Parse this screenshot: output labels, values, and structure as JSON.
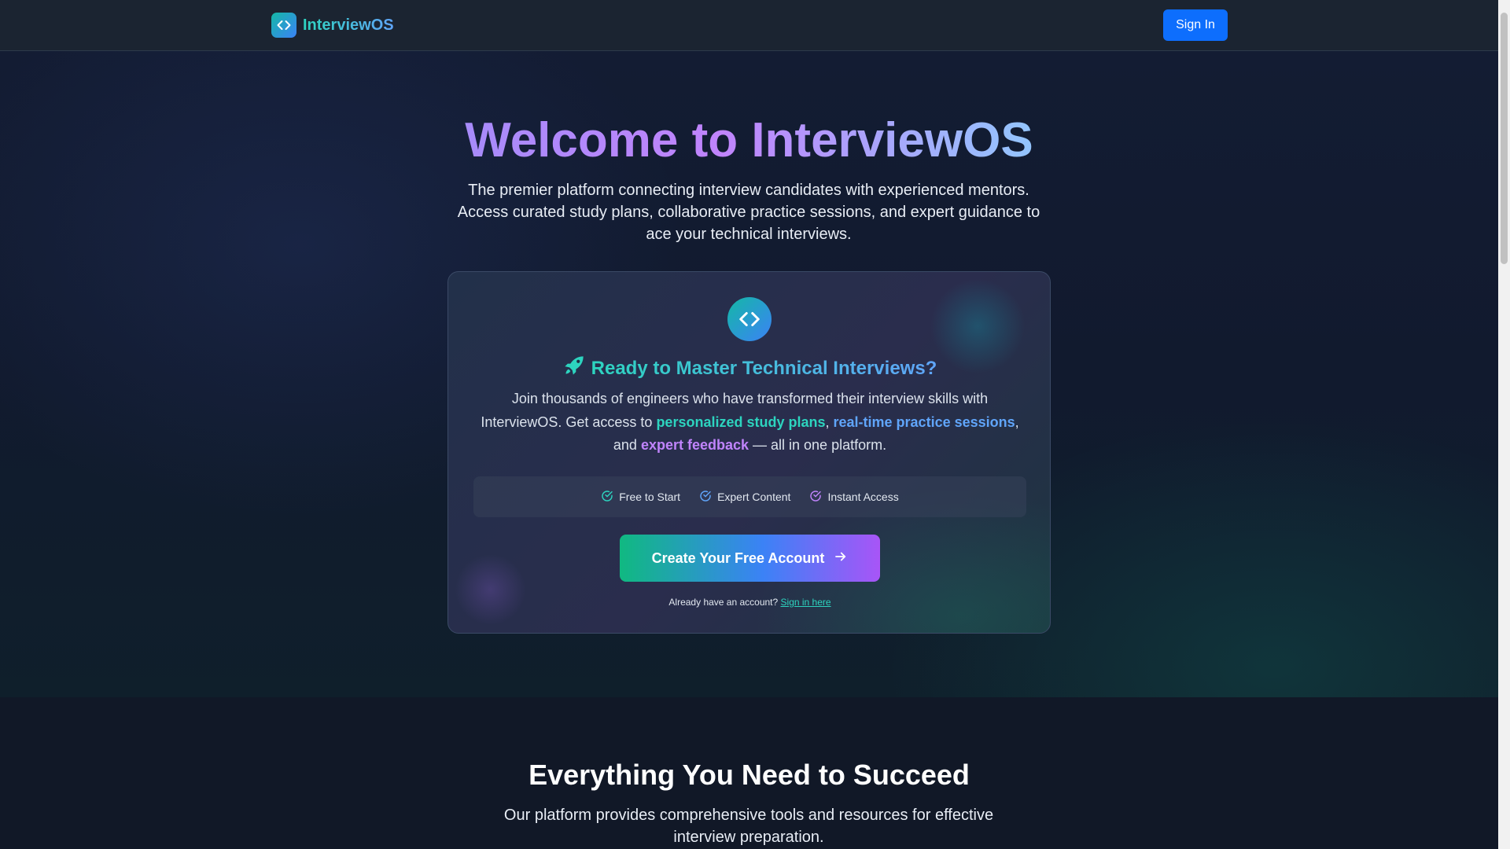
{
  "navbar": {
    "brand_name": "InterviewOS",
    "sign_in_label": "Sign In"
  },
  "hero": {
    "title": "Welcome to InterviewOS",
    "subtitle": "The premier platform connecting interview candidates with experienced mentors. Access curated study plans, collaborative practice sessions, and expert guidance to ace your technical interviews."
  },
  "card": {
    "heading": "Ready to Master Technical Interviews?",
    "desc_part1": "Join thousands of engineers who have transformed their interview skills with InterviewOS. Get access to ",
    "highlight1": "personalized study plans",
    "sep1": ", ",
    "highlight2": "real-time practice sessions",
    "sep2": ", and ",
    "highlight3": "expert feedback",
    "desc_part2": " — all in one platform.",
    "features": [
      {
        "label": "Free to Start",
        "color": "#2dd4bf"
      },
      {
        "label": "Expert Content",
        "color": "#60a5fa"
      },
      {
        "label": "Instant Access",
        "color": "#c084fc"
      }
    ],
    "cta_label": "Create Your Free Account",
    "signin_prompt": "Already have an account?",
    "signin_link": "Sign in here"
  },
  "features_section": {
    "title": "Everything You Need to Succeed",
    "subtitle": "Our platform provides comprehensive tools and resources for effective interview preparation."
  },
  "colors": {
    "primary_button": "#0d6efd",
    "accent_teal": "#2dd4bf",
    "accent_blue": "#60a5fa",
    "accent_purple": "#c084fc"
  }
}
